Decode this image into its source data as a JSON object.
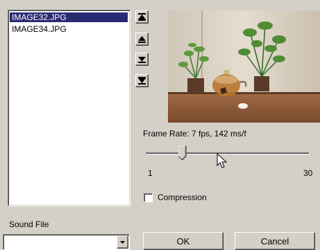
{
  "files": {
    "items": [
      {
        "label": "IMAGE32.JPG",
        "selected": true
      },
      {
        "label": "IMAGE34.JPG",
        "selected": false
      }
    ]
  },
  "order_buttons": {
    "icons": [
      "move-to-top-icon",
      "move-up-icon",
      "move-down-icon",
      "move-to-bottom-icon"
    ]
  },
  "preview": {
    "icon": "photo-preview-plants-teapot"
  },
  "frame_rate": {
    "label": "Frame Rate: 7 fps, 142 ms/f",
    "value": 7,
    "min_label": "1",
    "max_label": "30",
    "min": 1,
    "max": 30
  },
  "compression": {
    "label": "Compression",
    "checked": false
  },
  "sound_file": {
    "label": "Sound File",
    "value": ""
  },
  "actions": {
    "ok_label": "OK",
    "cancel_label": "Cancel"
  },
  "colors": {
    "face": "#d4d0c8",
    "selection": "#2a2a72"
  }
}
